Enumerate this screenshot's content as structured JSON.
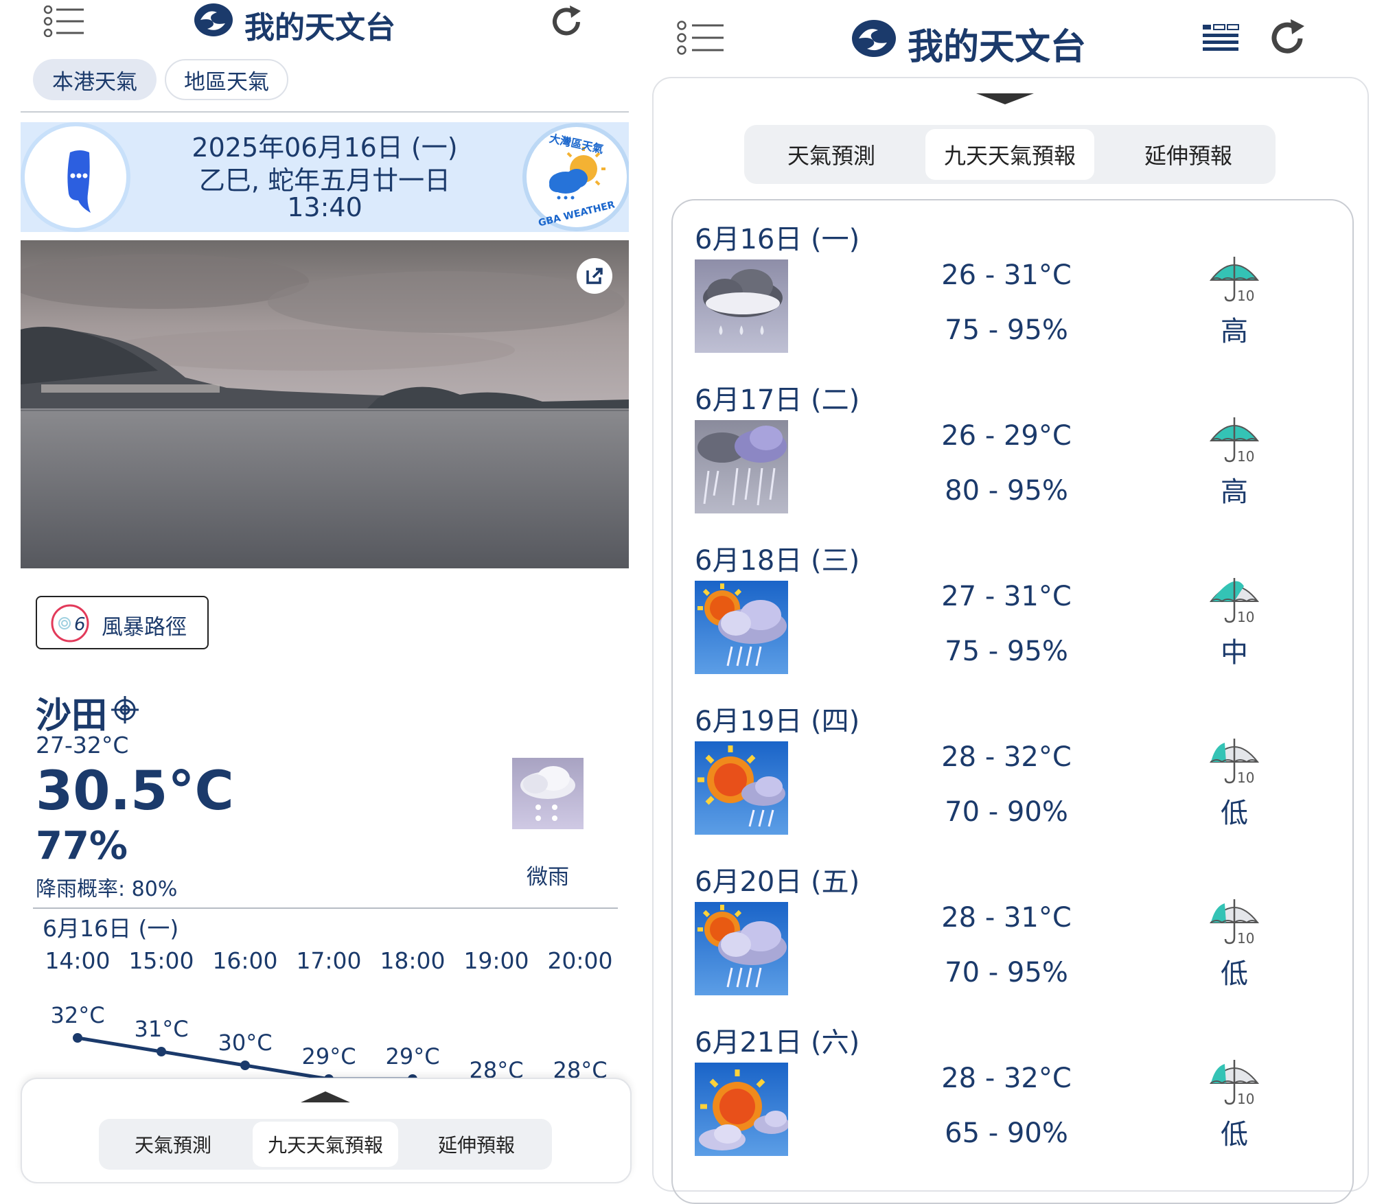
{
  "left": {
    "app_title": "我的天文台",
    "tabs": [
      {
        "label": "本港天氣",
        "active": true
      },
      {
        "label": "地區天氣",
        "active": false
      }
    ],
    "date_line": "2025年06月16日 (一)",
    "lunar_line": "乙巳, 蛇年五月廿一日",
    "time_line": "13:40",
    "gba_badge": {
      "arc_text": "大灣區天氣",
      "bottom_text": "GBA WEATHER"
    },
    "storm_button": "風暴路徑",
    "location": "沙田",
    "temp_range": "27-32°C",
    "current_temp": "30.5°C",
    "humidity": "77%",
    "rain_chance": "降雨概率: 80%",
    "weather_desc": "微雨",
    "hourly_date": "6月16日 (一)",
    "hours": [
      "14:00",
      "15:00",
      "16:00",
      "17:00",
      "18:00",
      "19:00",
      "20:00"
    ],
    "hourly_temps": [
      "32°C",
      "31°C",
      "30°C",
      "29°C",
      "29°C",
      "28°C",
      "28°C"
    ],
    "hourly_values": [
      32,
      31,
      30,
      29,
      29,
      28,
      28
    ],
    "bottom_tabs": [
      {
        "label": "天氣預測"
      },
      {
        "label": "九天天氣預報",
        "active": true
      },
      {
        "label": "延伸預報"
      }
    ]
  },
  "right": {
    "app_title": "我的天文台",
    "tabs": [
      {
        "label": "天氣預測"
      },
      {
        "label": "九天天氣預報",
        "active": true
      },
      {
        "label": "延伸預報"
      }
    ],
    "days": [
      {
        "date": "6月16日 (一)",
        "temp": "26 - 31°C",
        "humidity": "75 - 95%",
        "rain": "高",
        "icon": "rain-cloud-icon"
      },
      {
        "date": "6月17日 (二)",
        "temp": "26 - 29°C",
        "humidity": "80 - 95%",
        "rain": "高",
        "icon": "heavy-rain-icon"
      },
      {
        "date": "6月18日 (三)",
        "temp": "27 - 31°C",
        "humidity": "75 - 95%",
        "rain": "中",
        "icon": "sun-cloud-rain-icon"
      },
      {
        "date": "6月19日 (四)",
        "temp": "28 - 32°C",
        "humidity": "70 - 90%",
        "rain": "低",
        "icon": "sunny-shower-icon"
      },
      {
        "date": "6月20日 (五)",
        "temp": "28 - 31°C",
        "humidity": "70 - 95%",
        "rain": "低",
        "icon": "sun-cloud-rain-icon"
      },
      {
        "date": "6月21日 (六)",
        "temp": "28 - 32°C",
        "humidity": "65 - 90%",
        "rain": "低",
        "icon": "sunny-periods-icon"
      }
    ]
  },
  "colors": {
    "navy": "#1b3a6b",
    "umbrella": "#34c3b5",
    "sky_blue": "#2f6fc4"
  }
}
